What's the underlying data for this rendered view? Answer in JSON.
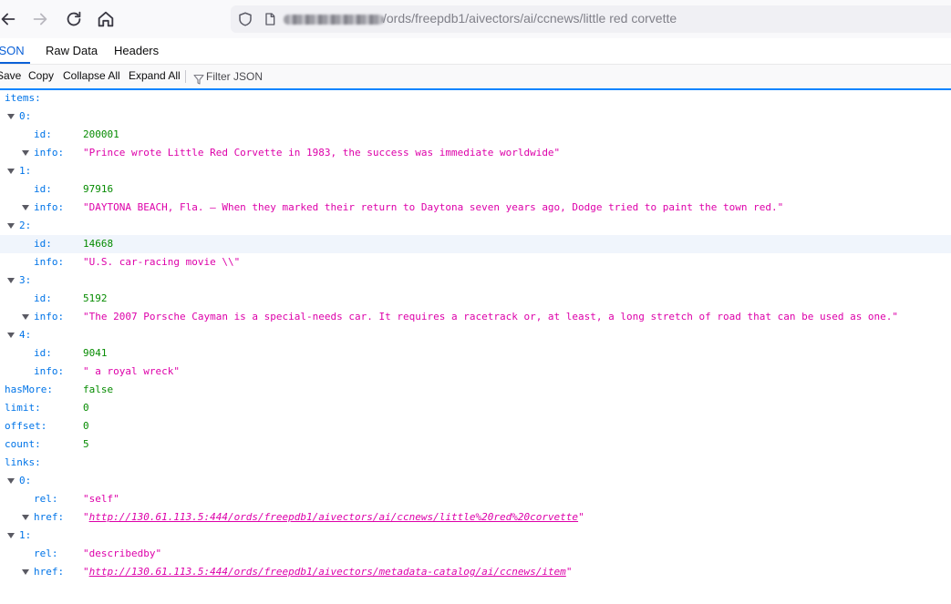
{
  "browser": {
    "url_path": "/ords/freepdb1/aivectors/ai/ccnews/little red corvette"
  },
  "viewer": {
    "tabs": [
      "JSON",
      "Raw Data",
      "Headers"
    ],
    "toolbar": {
      "save": "Save",
      "copy": "Copy",
      "collapse_all": "Collapse All",
      "expand_all": "Expand All",
      "filter_placeholder": "Filter JSON"
    }
  },
  "rows": [
    {
      "key": "items:",
      "value": "",
      "vtype": "",
      "level": 0,
      "twisty": false
    },
    {
      "key": "0:",
      "value": "",
      "vtype": "",
      "level": 1,
      "twisty": true
    },
    {
      "key": "id:",
      "value": "200001",
      "vtype": "num",
      "level": 2,
      "twisty": false
    },
    {
      "key": "info:",
      "value": "\"Prince wrote Little Red Corvette in 1983, the success was immediate worldwide\"",
      "vtype": "str",
      "level": 2,
      "twisty": true
    },
    {
      "key": "1:",
      "value": "",
      "vtype": "",
      "level": 1,
      "twisty": true
    },
    {
      "key": "id:",
      "value": "97916",
      "vtype": "num",
      "level": 2,
      "twisty": false
    },
    {
      "key": "info:",
      "value": "\"DAYTONA BEACH, Fla. – When they marked their return to Daytona seven years ago, Dodge tried to paint the town red.\"",
      "vtype": "str",
      "level": 2,
      "twisty": true
    },
    {
      "key": "2:",
      "value": "",
      "vtype": "",
      "level": 1,
      "twisty": true
    },
    {
      "key": "id:",
      "value": "14668",
      "vtype": "num",
      "level": 2,
      "twisty": false,
      "highlight": true
    },
    {
      "key": "info:",
      "value": "\"U.S. car-racing movie \\\\\"",
      "vtype": "str",
      "level": 2,
      "twisty": false
    },
    {
      "key": "3:",
      "value": "",
      "vtype": "",
      "level": 1,
      "twisty": true
    },
    {
      "key": "id:",
      "value": "5192",
      "vtype": "num",
      "level": 2,
      "twisty": false
    },
    {
      "key": "info:",
      "value": "\"The 2007 Porsche Cayman is a special-needs car. It requires a racetrack or, at least, a long stretch of road that can be used as one.\"",
      "vtype": "str",
      "level": 2,
      "twisty": true
    },
    {
      "key": "4:",
      "value": "",
      "vtype": "",
      "level": 1,
      "twisty": true
    },
    {
      "key": "id:",
      "value": "9041",
      "vtype": "num",
      "level": 2,
      "twisty": false
    },
    {
      "key": "info:",
      "value": "\" a royal wreck\"",
      "vtype": "str",
      "level": 2,
      "twisty": false
    },
    {
      "key": "hasMore:",
      "value": "false",
      "vtype": "bool",
      "level": 0,
      "twisty": false
    },
    {
      "key": "limit:",
      "value": "0",
      "vtype": "num",
      "level": 0,
      "twisty": false
    },
    {
      "key": "offset:",
      "value": "0",
      "vtype": "num",
      "level": 0,
      "twisty": false
    },
    {
      "key": "count:",
      "value": "5",
      "vtype": "num",
      "level": 0,
      "twisty": false
    },
    {
      "key": "links:",
      "value": "",
      "vtype": "",
      "level": 0,
      "twisty": false
    },
    {
      "key": "0:",
      "value": "",
      "vtype": "",
      "level": 1,
      "twisty": true
    },
    {
      "key": "rel:",
      "value": "\"self\"",
      "vtype": "str",
      "level": 2,
      "twisty": false
    },
    {
      "key": "href:",
      "value": "http://130.61.113.5:444/ords/freepdb1/aivectors/ai/ccnews/little%20red%20corvette",
      "vtype": "link",
      "level": 2,
      "twisty": true
    },
    {
      "key": "1:",
      "value": "",
      "vtype": "",
      "level": 1,
      "twisty": true
    },
    {
      "key": "rel:",
      "value": "\"describedby\"",
      "vtype": "str",
      "level": 2,
      "twisty": false
    },
    {
      "key": "href:",
      "value": "http://130.61.113.5:444/ords/freepdb1/aivectors/metadata-catalog/ai/ccnews/item",
      "vtype": "link",
      "level": 2,
      "twisty": true
    }
  ]
}
